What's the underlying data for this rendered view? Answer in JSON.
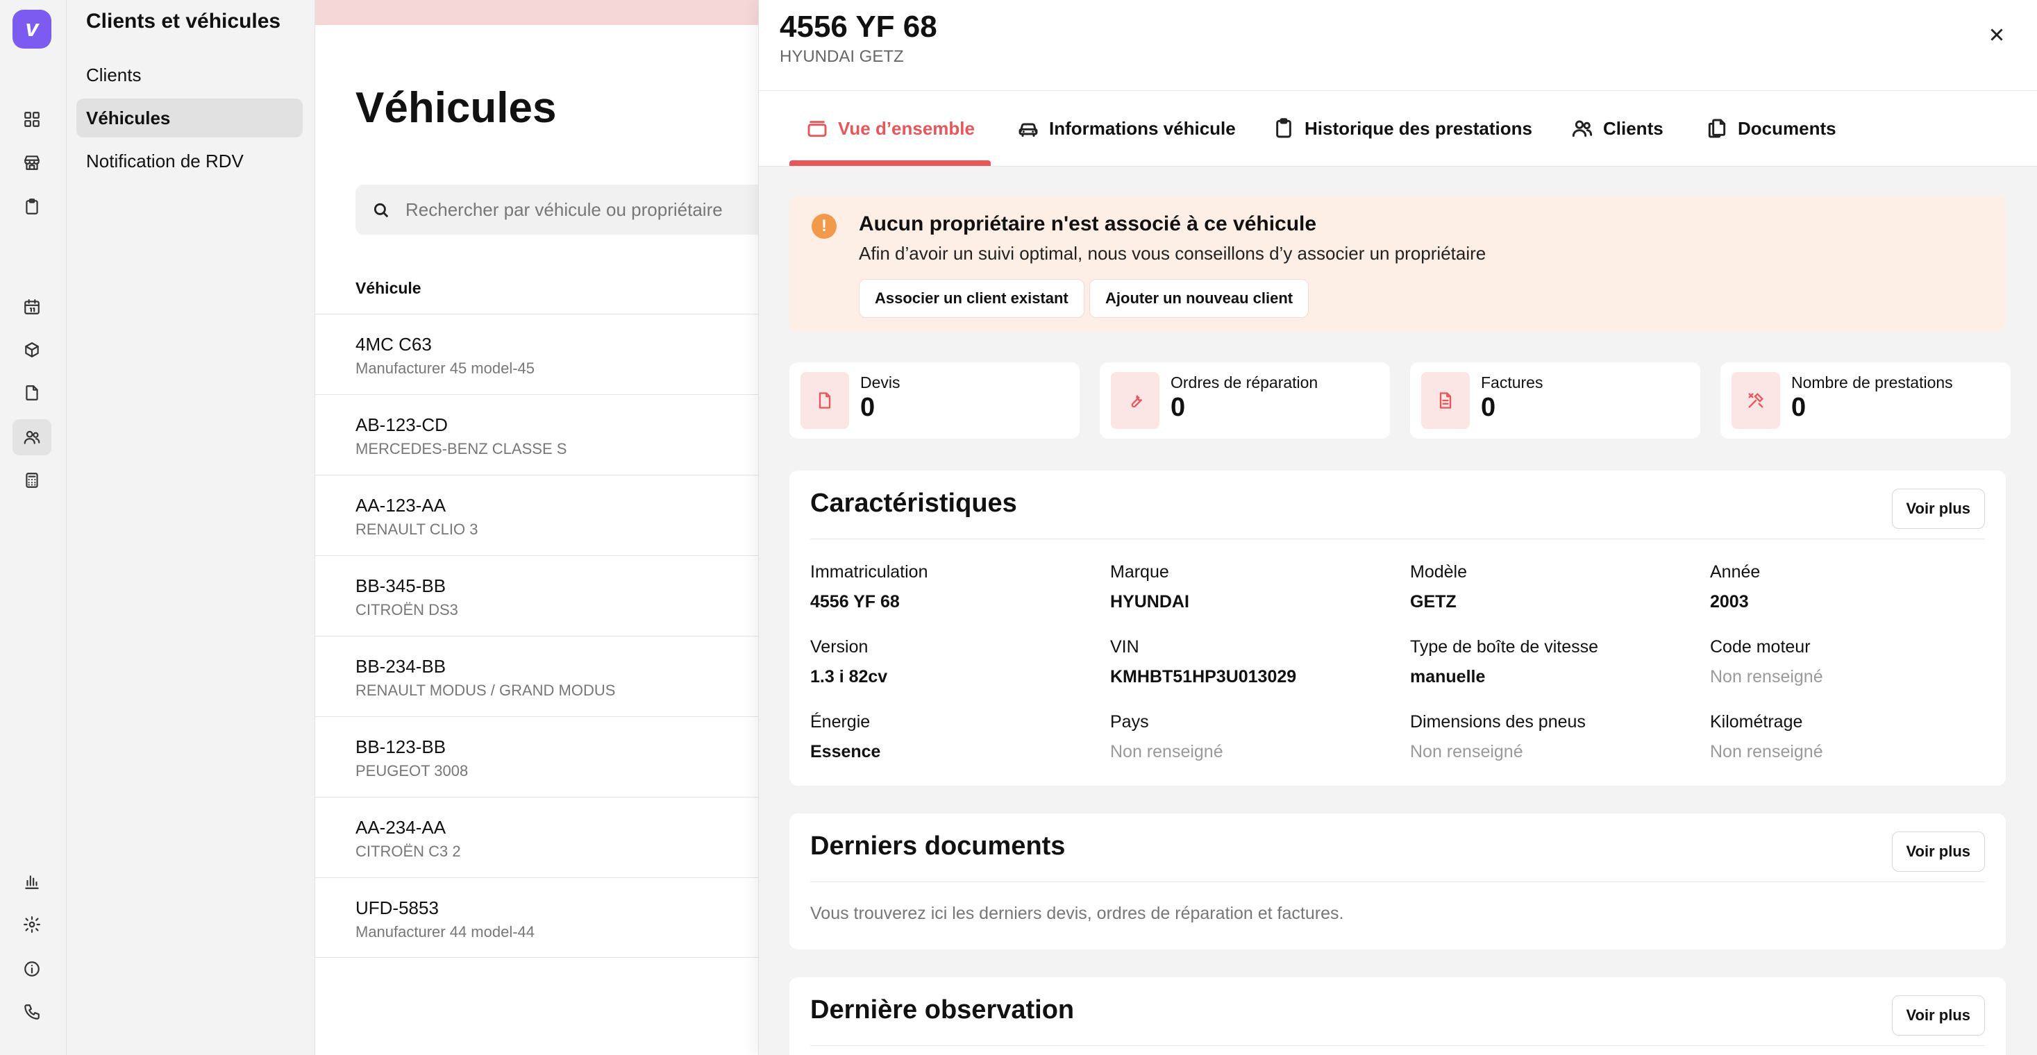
{
  "app": {
    "logo_letter": "v"
  },
  "submenu": {
    "title": "Clients et véhicules",
    "items": [
      {
        "label": "Clients",
        "active": false
      },
      {
        "label": "Véhicules",
        "active": true
      },
      {
        "label": "Notification de RDV",
        "active": false
      }
    ]
  },
  "list": {
    "title": "Véhicules",
    "search_placeholder": "Rechercher par véhicule ou propriétaire",
    "column_header": "Véhicule",
    "rows": [
      {
        "plate": "4MC C63",
        "model": "Manufacturer 45 model-45"
      },
      {
        "plate": "AB-123-CD",
        "model": "MERCEDES-BENZ CLASSE S"
      },
      {
        "plate": "AA-123-AA",
        "model": "RENAULT CLIO 3"
      },
      {
        "plate": "BB-345-BB",
        "model": "CITROËN DS3"
      },
      {
        "plate": "BB-234-BB",
        "model": "RENAULT MODUS / GRAND MODUS"
      },
      {
        "plate": "BB-123-BB",
        "model": "PEUGEOT 3008"
      },
      {
        "plate": "AA-234-AA",
        "model": "CITROËN C3 2"
      },
      {
        "plate": "UFD-5853",
        "model": "Manufacturer 44 model-44"
      }
    ]
  },
  "panel": {
    "title": "4556 YF 68",
    "subtitle": "HYUNDAI GETZ",
    "tabs": [
      {
        "label": "Vue d’ensemble",
        "icon": "overview-icon",
        "active": true
      },
      {
        "label": "Informations véhicule",
        "icon": "car-icon",
        "active": false
      },
      {
        "label": "Historique des prestations",
        "icon": "clipboard-icon",
        "active": false
      },
      {
        "label": "Clients",
        "icon": "users-icon",
        "active": false
      },
      {
        "label": "Documents",
        "icon": "documents-icon",
        "active": false
      }
    ],
    "alert": {
      "title": "Aucun propriétaire n'est associé à ce véhicule",
      "text": "Afin d’avoir un suivi optimal, nous vous conseillons d’y associer un propriétaire",
      "button_existing": "Associer un client existant",
      "button_new": "Ajouter un nouveau client",
      "icon_text": "!"
    },
    "stats": [
      {
        "label": "Devis",
        "value": "0",
        "icon": "file-icon"
      },
      {
        "label": "Ordres de réparation",
        "value": "0",
        "icon": "wrench-icon"
      },
      {
        "label": "Factures",
        "value": "0",
        "icon": "invoice-icon"
      },
      {
        "label": "Nombre de prestations",
        "value": "0",
        "icon": "tools-icon"
      }
    ],
    "caracteristiques": {
      "title": "Caractéristiques",
      "button": "Voir plus",
      "fields": [
        {
          "label": "Immatriculation",
          "value": "4556 YF 68",
          "empty": false
        },
        {
          "label": "Marque",
          "value": "HYUNDAI",
          "empty": false
        },
        {
          "label": "Modèle",
          "value": "GETZ",
          "empty": false
        },
        {
          "label": "Année",
          "value": "2003",
          "empty": false
        },
        {
          "label": "Version",
          "value": "1.3 i 82cv",
          "empty": false
        },
        {
          "label": "VIN",
          "value": "KMHBT51HP3U013029",
          "empty": false
        },
        {
          "label": "Type de boîte de vitesse",
          "value": "manuelle",
          "empty": false
        },
        {
          "label": "Code moteur",
          "value": "Non renseigné",
          "empty": true
        },
        {
          "label": "Énergie",
          "value": "Essence",
          "empty": false
        },
        {
          "label": "Pays",
          "value": "Non renseigné",
          "empty": true
        },
        {
          "label": "Dimensions des pneus",
          "value": "Non renseigné",
          "empty": true
        },
        {
          "label": "Kilométrage",
          "value": "Non renseigné",
          "empty": true
        }
      ]
    },
    "documents": {
      "title": "Derniers documents",
      "button": "Voir plus",
      "text": "Vous trouverez ici les derniers devis, ordres de réparation et factures."
    },
    "observation": {
      "title": "Dernière observation",
      "button": "Voir plus"
    }
  },
  "colors": {
    "accent": "#e8565a",
    "brand": "#7c5cf0",
    "alert_bg": "#fdeee6",
    "alert_icon": "#f2994a"
  }
}
